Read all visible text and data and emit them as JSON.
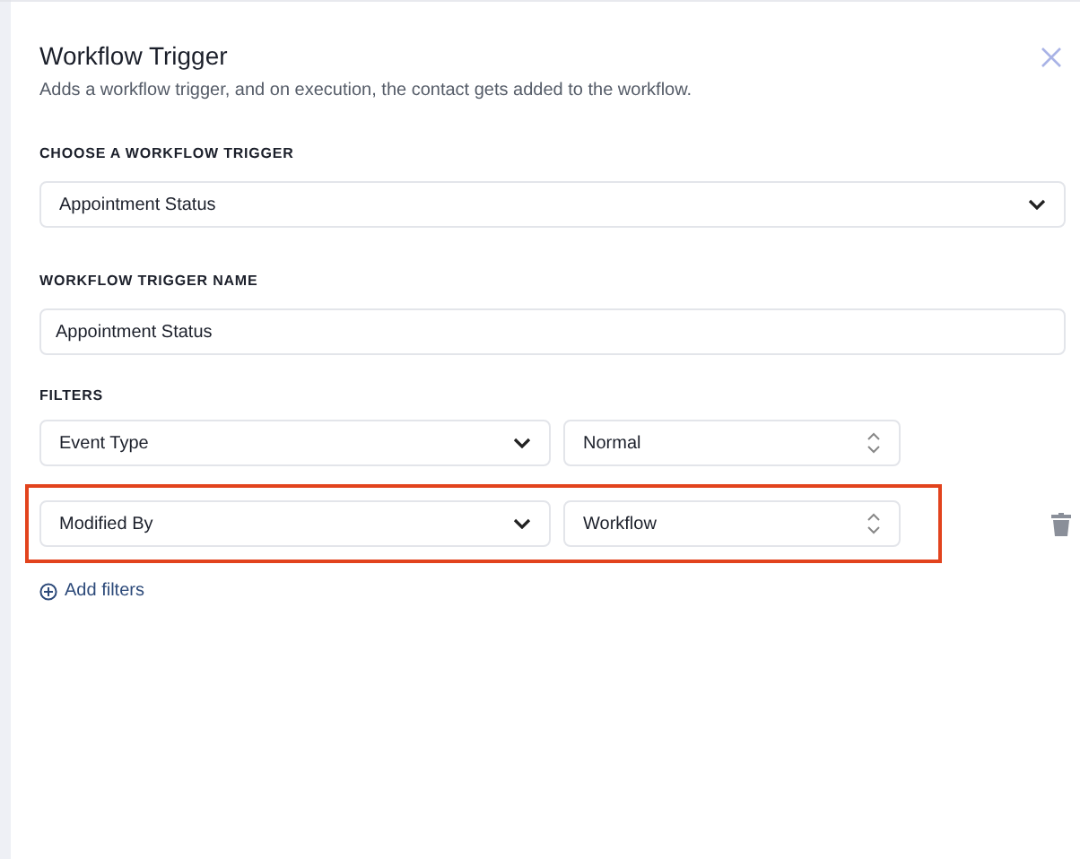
{
  "panel": {
    "title": "Workflow Trigger",
    "description": "Adds a workflow trigger, and on execution, the contact gets added to the workflow."
  },
  "trigger": {
    "label": "CHOOSE A WORKFLOW TRIGGER",
    "value": "Appointment Status"
  },
  "trigger_name": {
    "label": "WORKFLOW TRIGGER NAME",
    "value": "Appointment Status"
  },
  "filters": {
    "label": "FILTERS",
    "rows": [
      {
        "field": "Event Type",
        "value": "Normal",
        "highlighted": false,
        "deletable": false
      },
      {
        "field": "Modified By",
        "value": "Workflow",
        "highlighted": true,
        "deletable": true
      }
    ],
    "add_label": "Add filters"
  }
}
